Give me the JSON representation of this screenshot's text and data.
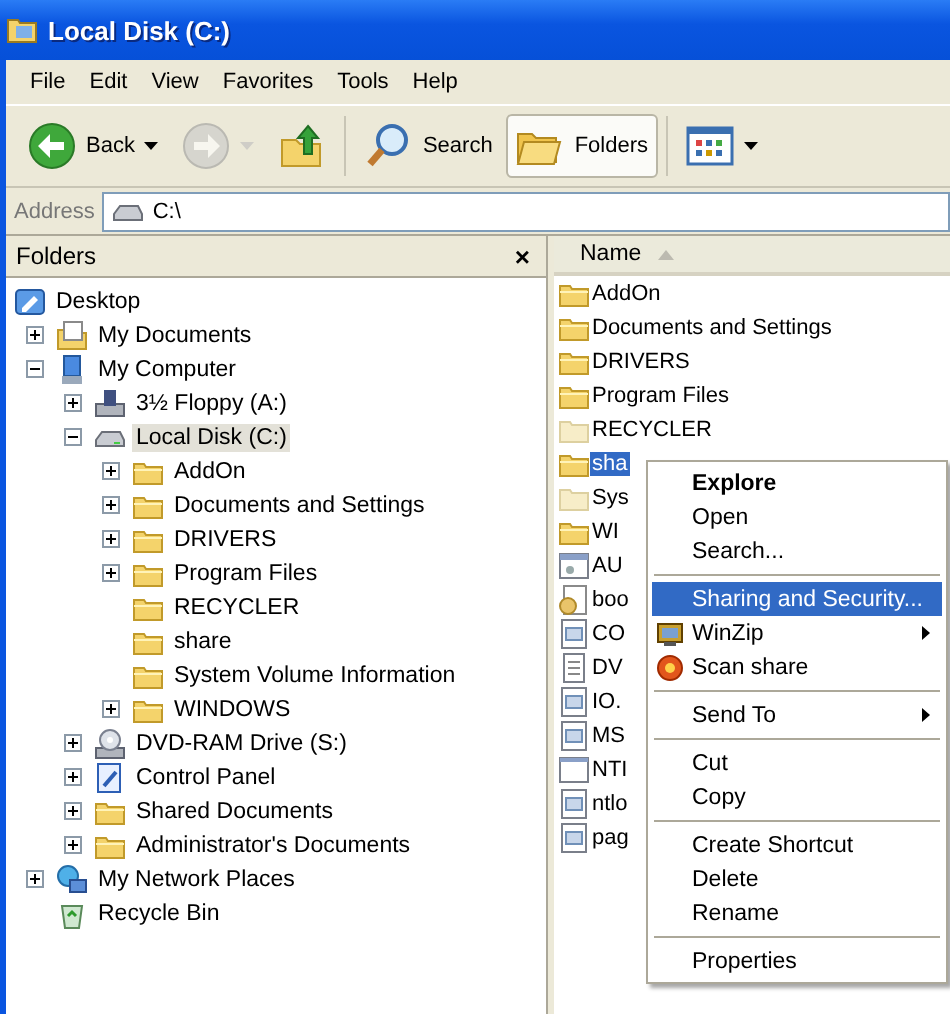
{
  "window": {
    "title": "Local Disk (C:)"
  },
  "menu_bar": [
    "File",
    "Edit",
    "View",
    "Favorites",
    "Tools",
    "Help"
  ],
  "toolbar": [
    {
      "kind": "back",
      "label": "Back",
      "dropdown": true,
      "disabled": false,
      "selected": false
    },
    {
      "kind": "forward",
      "dropdown": true,
      "disabled": true,
      "selected": false
    },
    {
      "kind": "up",
      "dropdown": false,
      "disabled": false,
      "selected": false
    },
    {
      "kind": "search",
      "label": "Search",
      "dropdown": false,
      "disabled": false,
      "selected": false
    },
    {
      "kind": "folders",
      "label": "Folders",
      "dropdown": false,
      "disabled": false,
      "selected": true
    },
    {
      "kind": "views",
      "dropdown": true,
      "disabled": false,
      "selected": false
    }
  ],
  "address": {
    "label": "Address",
    "value": "C:\\"
  },
  "folders_pane": {
    "title": "Folders",
    "close": "×",
    "tree": [
      {
        "label": "Desktop",
        "kind": "desktop",
        "selected": false,
        "children": [
          {
            "label": "My Documents",
            "kind": "documents",
            "expanded": false,
            "selected": false
          },
          {
            "label": "My Computer",
            "kind": "computer",
            "expanded": true,
            "selected": false,
            "children": [
              {
                "label": "3½ Floppy (A:)",
                "kind": "floppy",
                "expanded": false,
                "selected": false
              },
              {
                "label": "Local Disk (C:)",
                "kind": "disk",
                "expanded": true,
                "selected": true,
                "children": [
                  {
                    "label": "AddOn",
                    "kind": "folder",
                    "expanded": false,
                    "selected": false
                  },
                  {
                    "label": "Documents and Settings",
                    "kind": "folder",
                    "expanded": false,
                    "selected": false
                  },
                  {
                    "label": "DRIVERS",
                    "kind": "folder",
                    "expanded": false,
                    "selected": false
                  },
                  {
                    "label": "Program Files",
                    "kind": "folder",
                    "expanded": false,
                    "selected": false
                  },
                  {
                    "label": "RECYCLER",
                    "kind": "folder",
                    "selected": false
                  },
                  {
                    "label": "share",
                    "kind": "folder",
                    "selected": false
                  },
                  {
                    "label": "System Volume Information",
                    "kind": "folder",
                    "selected": false
                  },
                  {
                    "label": "WINDOWS",
                    "kind": "folder",
                    "expanded": false,
                    "selected": false
                  }
                ]
              },
              {
                "label": "DVD-RAM Drive (S:)",
                "kind": "dvd",
                "expanded": false,
                "selected": false
              },
              {
                "label": "Control Panel",
                "kind": "control",
                "expanded": false,
                "selected": false
              },
              {
                "label": "Shared Documents",
                "kind": "folder",
                "expanded": false,
                "selected": false
              },
              {
                "label": "Administrator's Documents",
                "kind": "folder",
                "expanded": false,
                "selected": false
              }
            ]
          },
          {
            "label": "My Network Places",
            "kind": "network",
            "expanded": false,
            "selected": false
          },
          {
            "label": "Recycle Bin",
            "kind": "recycle",
            "selected": false
          }
        ]
      }
    ]
  },
  "file_list": {
    "columns": [
      {
        "label": "Name",
        "sorted": true
      }
    ],
    "items": [
      {
        "name": "AddOn",
        "kind": "folder",
        "selected": false
      },
      {
        "name": "Documents and Settings",
        "kind": "folder",
        "selected": false
      },
      {
        "name": "DRIVERS",
        "kind": "folder",
        "selected": false
      },
      {
        "name": "Program Files",
        "kind": "folder",
        "selected": false
      },
      {
        "name": "RECYCLER",
        "kind": "hidden-folder",
        "selected": false
      },
      {
        "name": "sha",
        "kind": "folder",
        "selected": true
      },
      {
        "name": "Sys",
        "kind": "hidden-folder",
        "selected": false
      },
      {
        "name": "WI",
        "kind": "folder",
        "selected": false
      },
      {
        "name": "AU",
        "kind": "batch",
        "selected": false
      },
      {
        "name": "boo",
        "kind": "settings",
        "selected": false
      },
      {
        "name": "CO",
        "kind": "system",
        "selected": false
      },
      {
        "name": "DV",
        "kind": "text",
        "selected": false
      },
      {
        "name": "IO.",
        "kind": "system",
        "selected": false
      },
      {
        "name": "MS",
        "kind": "system",
        "selected": false
      },
      {
        "name": "NTI",
        "kind": "window",
        "selected": false
      },
      {
        "name": "ntlo",
        "kind": "system",
        "selected": false
      },
      {
        "name": "pag",
        "kind": "system",
        "selected": false
      }
    ]
  },
  "context_menu": {
    "items": [
      {
        "kind": "default",
        "label": "Explore",
        "selected": false,
        "submenu": false
      },
      {
        "kind": "item",
        "label": "Open",
        "selected": false,
        "submenu": false
      },
      {
        "kind": "item",
        "label": "Search...",
        "selected": false,
        "submenu": false
      },
      {
        "kind": "separator"
      },
      {
        "kind": "item",
        "label": "Sharing and Security...",
        "selected": true,
        "submenu": false
      },
      {
        "kind": "zip",
        "label": "WinZip",
        "selected": false,
        "submenu": true
      },
      {
        "kind": "scan",
        "label": "Scan share",
        "selected": false,
        "submenu": false
      },
      {
        "kind": "separator"
      },
      {
        "kind": "item",
        "label": "Send To",
        "selected": false,
        "submenu": true
      },
      {
        "kind": "separator"
      },
      {
        "kind": "item",
        "label": "Cut",
        "selected": false,
        "submenu": false
      },
      {
        "kind": "item",
        "label": "Copy",
        "selected": false,
        "submenu": false
      },
      {
        "kind": "separator"
      },
      {
        "kind": "item",
        "label": "Create Shortcut",
        "selected": false,
        "submenu": false
      },
      {
        "kind": "item",
        "label": "Delete",
        "selected": false,
        "submenu": false
      },
      {
        "kind": "item",
        "label": "Rename",
        "selected": false,
        "submenu": false
      },
      {
        "kind": "separator"
      },
      {
        "kind": "item",
        "label": "Properties",
        "selected": false,
        "submenu": false
      }
    ]
  }
}
